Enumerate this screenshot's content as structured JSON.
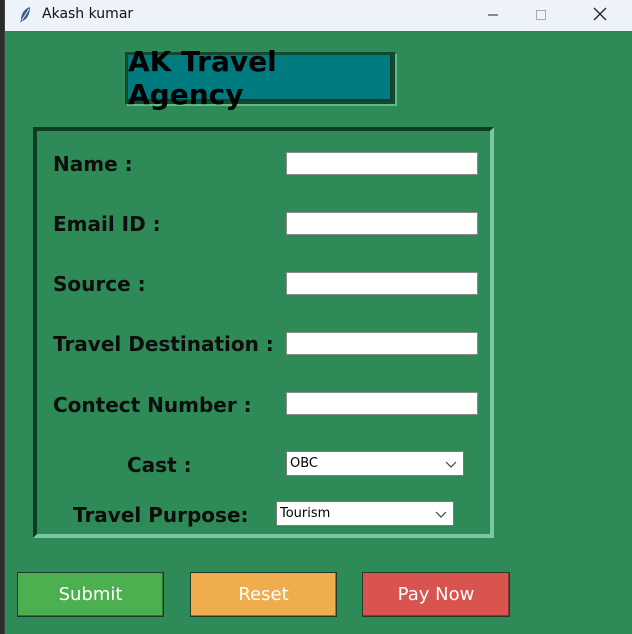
{
  "window": {
    "title": "Akash kumar",
    "icon": "feather-icon"
  },
  "heading": "AK Travel Agency",
  "form": {
    "name_label": "Name :",
    "name_value": "",
    "email_label": "Email ID :",
    "email_value": "",
    "source_label": "Source :",
    "source_value": "",
    "destination_label": "Travel Destination :",
    "destination_value": "",
    "contact_label": "Contect Number :",
    "contact_value": "",
    "cast_label": "Cast :",
    "cast_selected": "OBC",
    "purpose_label": "Travel Purpose:",
    "purpose_selected": "Tourism"
  },
  "buttons": {
    "submit": "Submit",
    "reset": "Reset",
    "pay_now": "Pay Now"
  },
  "colors": {
    "window_bg": "#2e8b57",
    "heading_bg": "#007b7f",
    "submit": "#4caf50",
    "reset": "#f0ad4e",
    "pay_now": "#d9534f"
  }
}
